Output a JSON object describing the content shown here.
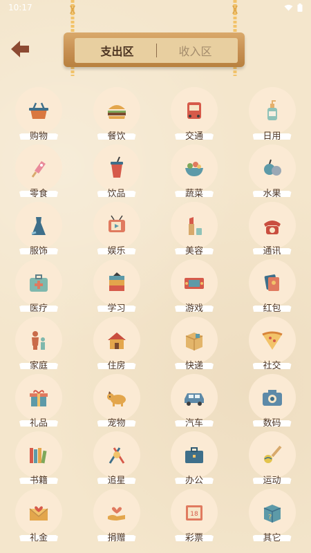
{
  "status_bar": {
    "time": "10:17"
  },
  "tabs": {
    "expense": "支出区",
    "income": "收入区"
  },
  "categories": [
    {
      "label": "购物",
      "icon": "basket-icon"
    },
    {
      "label": "餐饮",
      "icon": "burger-icon"
    },
    {
      "label": "交通",
      "icon": "bus-icon"
    },
    {
      "label": "日用",
      "icon": "bottle-icon"
    },
    {
      "label": "零食",
      "icon": "popsicle-icon"
    },
    {
      "label": "饮品",
      "icon": "drink-cup-icon"
    },
    {
      "label": "蔬菜",
      "icon": "salad-bowl-icon"
    },
    {
      "label": "水果",
      "icon": "fruit-icon"
    },
    {
      "label": "服饰",
      "icon": "dress-icon"
    },
    {
      "label": "娱乐",
      "icon": "tv-icon"
    },
    {
      "label": "美容",
      "icon": "lipstick-icon"
    },
    {
      "label": "通讯",
      "icon": "telephone-icon"
    },
    {
      "label": "医疗",
      "icon": "medical-kit-icon"
    },
    {
      "label": "学习",
      "icon": "books-icon"
    },
    {
      "label": "游戏",
      "icon": "game-console-icon"
    },
    {
      "label": "红包",
      "icon": "red-envelope-icon"
    },
    {
      "label": "家庭",
      "icon": "family-icon"
    },
    {
      "label": "住房",
      "icon": "house-icon"
    },
    {
      "label": "快递",
      "icon": "parcel-icon"
    },
    {
      "label": "社交",
      "icon": "pizza-icon"
    },
    {
      "label": "礼品",
      "icon": "gift-icon"
    },
    {
      "label": "宠物",
      "icon": "dog-icon"
    },
    {
      "label": "汽车",
      "icon": "car-icon"
    },
    {
      "label": "数码",
      "icon": "camera-icon"
    },
    {
      "label": "书籍",
      "icon": "bookshelf-icon"
    },
    {
      "label": "追星",
      "icon": "lightstick-icon"
    },
    {
      "label": "办公",
      "icon": "briefcase-icon"
    },
    {
      "label": "运动",
      "icon": "sports-icon"
    },
    {
      "label": "礼金",
      "icon": "envelope-heart-icon"
    },
    {
      "label": "捐赠",
      "icon": "donation-icon"
    },
    {
      "label": "彩票",
      "icon": "lottery-icon"
    },
    {
      "label": "其它",
      "icon": "question-box-icon"
    }
  ],
  "colors": {
    "background": "#f4e6cc",
    "circle": "#fbead4",
    "sign_wood": "#c68f52",
    "back_arrow": "#8c4a32",
    "active_tab": "#4a3220",
    "inactive_tab": "#a48c6c"
  }
}
